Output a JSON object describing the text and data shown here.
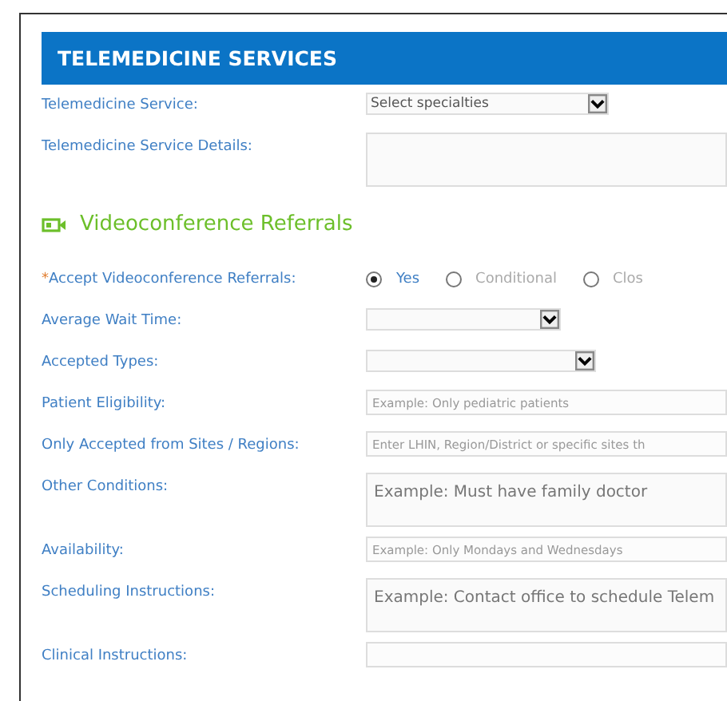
{
  "section": {
    "title": "TELEMEDICINE SERVICES"
  },
  "service_fields": [
    {
      "kind": "select",
      "label": "Telemedicine Service:",
      "value": "Select specialties"
    },
    {
      "kind": "textarea",
      "label": "Telemedicine Service Details:"
    }
  ],
  "subsection": {
    "title": "Videoconference Referrals"
  },
  "fields": [
    {
      "kind": "radio",
      "label": "Accept Videoconference Referrals:",
      "marker": "*",
      "options": [
        {
          "label": "Yes",
          "selected": true
        },
        {
          "label": "Conditional",
          "selected": false
        },
        {
          "label": "Clos",
          "selected": false
        }
      ]
    },
    {
      "kind": "select",
      "label": "Average Wait Time:"
    },
    {
      "kind": "select",
      "label": "Accepted Types:"
    },
    {
      "kind": "input",
      "label": "Patient Eligibility:",
      "placeholder": "Example: Only pediatric patients"
    },
    {
      "kind": "input",
      "label": "Only Accepted from Sites / Regions:",
      "placeholder": "Enter LHIN, Region/District or specific sites th"
    },
    {
      "kind": "textarea",
      "label": "Other Conditions:",
      "placeholder": "Example: Must have family doctor"
    },
    {
      "kind": "input",
      "label": "Availability:",
      "placeholder": "Example: Only Mondays and Wednesdays"
    },
    {
      "kind": "textarea",
      "label": "Scheduling Instructions:",
      "placeholder": "Example: Contact office to schedule Telem"
    },
    {
      "kind": "input",
      "label": "Clinical Instructions:"
    }
  ]
}
